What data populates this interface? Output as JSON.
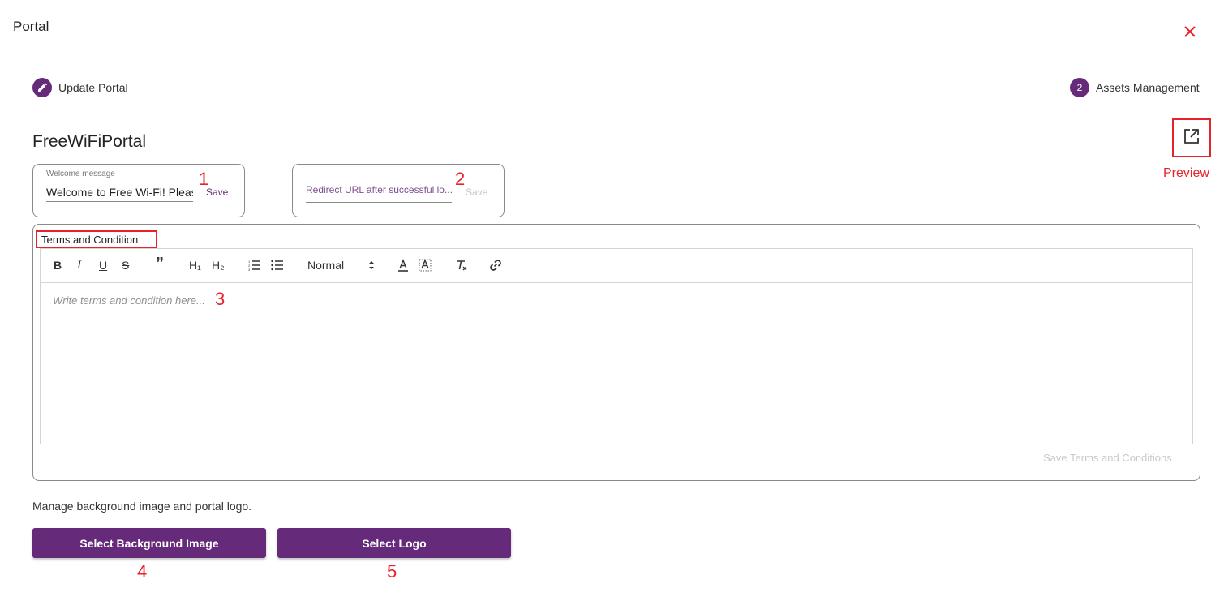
{
  "dialog": {
    "title": "Portal"
  },
  "stepper": {
    "steps": [
      {
        "label": "Update Portal",
        "icon": "pencil-icon",
        "state": "completed"
      },
      {
        "label": "Assets Management",
        "number": "2",
        "state": "active"
      }
    ]
  },
  "portal": {
    "name": "FreeWiFiPortal"
  },
  "preview": {
    "label": "Preview",
    "icon": "open-in-new-icon"
  },
  "welcome": {
    "label": "Welcome message",
    "value": "Welcome to Free Wi-Fi! Pleas",
    "save_label": "Save"
  },
  "redirect": {
    "placeholder": "Redirect URL after successful lo...",
    "value": "",
    "save_label": "Save"
  },
  "terms": {
    "label": "Terms and Condition",
    "placeholder": "Write terms and condition here...",
    "toolbar": {
      "bold": "B",
      "italic": "I",
      "underline": "U",
      "strike": "S",
      "quote": "”",
      "h1": "H₁",
      "h2": "H₂",
      "format": "Normal"
    },
    "save_label": "Save Terms and Conditions"
  },
  "assets": {
    "description": "Manage background image and portal logo.",
    "background_button": "Select Background Image",
    "logo_button": "Select Logo"
  },
  "annotations": [
    "1",
    "2",
    "3",
    "4",
    "5"
  ],
  "colors": {
    "primary": "#662a7b",
    "annotation": "#e8222b",
    "disabled": "#c4c4c4"
  }
}
